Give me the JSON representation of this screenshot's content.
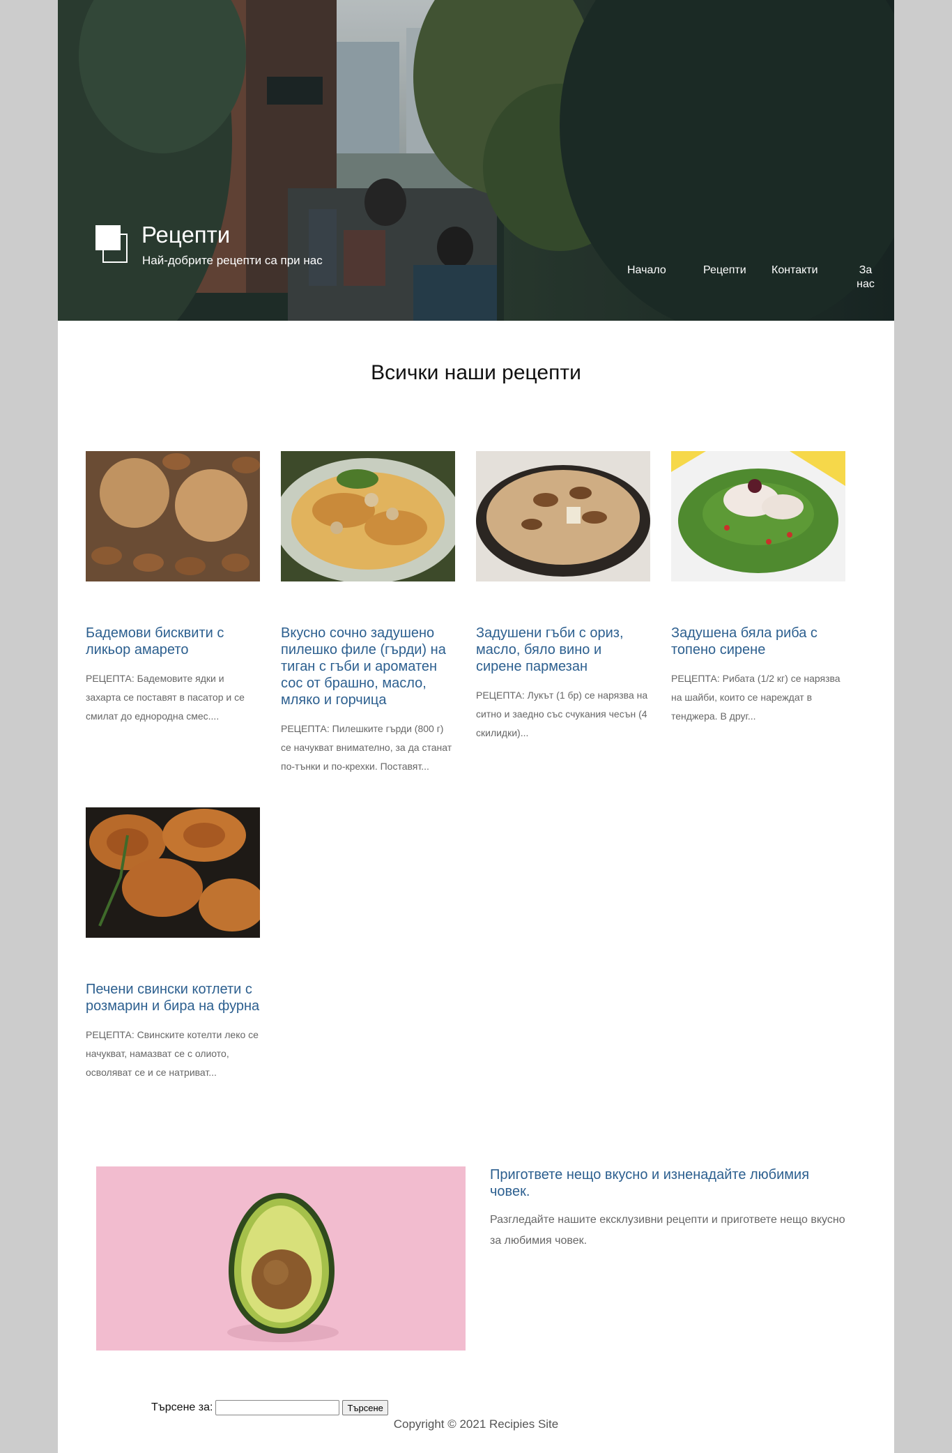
{
  "header": {
    "site_title": "Рецепти",
    "tagline": "Най-добрите рецепти са при нас",
    "nav": [
      {
        "label": "Начало"
      },
      {
        "label": "Рецепти"
      },
      {
        "label": "Контакти"
      },
      {
        "label": "За нас"
      }
    ]
  },
  "main": {
    "section_title": "Всички наши рецепти",
    "recipes": [
      {
        "title": "Бадемови бисквити с ликьор амарето",
        "excerpt": "РЕЦЕПТА: Бадемовите ядки и захарта се поставят в пасатор и се смилат до еднородна смес...."
      },
      {
        "title": "Вкусно сочно задушено пилешко филе (гърди) на тиган с гъби и ароматен сос от брашно, масло, мляко и горчица",
        "excerpt": "РЕЦЕПТА: Пилешките гърди (800 г) се начукват внимателно, за да станат по-тънки и по-крехки. Поставят..."
      },
      {
        "title": "Задушени гъби с ориз, масло, бяло вино и сирене пармезан",
        "excerpt": "РЕЦЕПТА: Лукът (1 бр) се нарязва на ситно и заедно със счукания чесън (4 скилидки)..."
      },
      {
        "title": "Задушена бяла риба с топено сирене",
        "excerpt": "РЕЦЕПТА: Рибата (1/2 кг) се нарязва на шайби, които се нареждат в тенджера. В друг..."
      },
      {
        "title": "Печени свински котлети с розмарин и бира на фурна",
        "excerpt": "РЕЦЕПТА: Свинските котелти леко се начукват, намазват се с олиото, осволяват се и се натриват..."
      }
    ]
  },
  "promo": {
    "title": "Пригответе нещо вкусно и изненадайте любимия човек.",
    "text": "Разгледайте нашите ексклузивни рецепти и пригответе нещо вкусно за любимия човек."
  },
  "footer": {
    "search_label": "Търсене за:",
    "search_value": "",
    "search_button": "Търсене",
    "copyright": "Copyright © 2021 Recipies Site"
  }
}
